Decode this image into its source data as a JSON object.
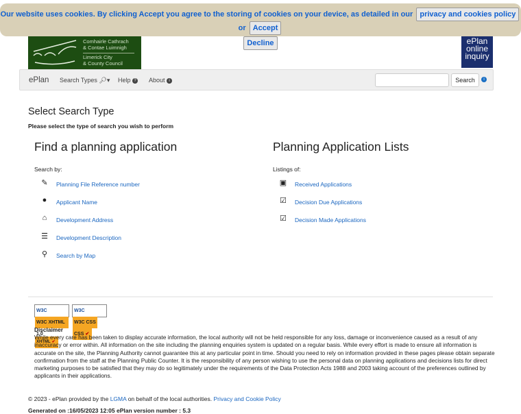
{
  "cookie": {
    "message": "Our website uses cookies. By clicking Accept you agree to the storing of cookies on your device, as detailed in our",
    "policy_button": "privacy and cookies policy",
    "or": "or",
    "accept": "Accept",
    "decline": "Decline"
  },
  "header": {
    "council_line1": "Comhairle Cathrach",
    "council_line2": "& Contae Luimnigh",
    "council_line3": "Limerick City",
    "council_line4": "& County Council",
    "eplan_logo": "ePlan online inquiry"
  },
  "nav": {
    "brand": "ePlan",
    "search_types": "Search Types",
    "help": "Help",
    "about": "About",
    "search_placeholder": "",
    "search_button": "Search"
  },
  "page": {
    "title": "Select Search Type",
    "subtitle": "Please select the type of search you wish to perform"
  },
  "find": {
    "heading": "Find a planning application",
    "label": "Search by:",
    "items": [
      {
        "label": "Planning File Reference number",
        "icon": "pencil-icon"
      },
      {
        "label": "Applicant Name",
        "icon": "user-icon"
      },
      {
        "label": "Development Address",
        "icon": "home-icon"
      },
      {
        "label": "Development Description",
        "icon": "list-icon"
      },
      {
        "label": "Search by Map",
        "icon": "map-marker-icon"
      }
    ]
  },
  "lists": {
    "heading": "Planning Application Lists",
    "label": "Listings of:",
    "items": [
      {
        "label": "Received Applications",
        "icon": "inbox-icon"
      },
      {
        "label": "Decision Due Applications",
        "icon": "edit-icon"
      },
      {
        "label": "Decision Made Applications",
        "icon": "check-icon"
      }
    ]
  },
  "badges": {
    "xhtml": "W3C XHTML 1.0",
    "css": "W3C CSS"
  },
  "disclaimer": {
    "title": "Disclaimer",
    "text": "While every care has been taken to display accurate information, the local authority will not be held responsible for any loss, damage or inconvenience caused as a result of any inaccuracy or error within. All information on the site including the planning enquiries system is updated on a regular basis. While every effort is made to ensure all information is accurate on the site, the Planning Authority cannot guarantee this at any particular point in time. Should you need to rely on information provided in these pages please obtain separate confirmation from the staff at the Planning Public Counter. It is the responsibility of any person wishing to use the personal data on planning applications and decisions lists for direct marketing purposes to be satisfied that they may do so legitimately under the requirements of the Data Protection Acts 1988 and 2003 taking account of the preferences outlined by applicants in their applications."
  },
  "footer": {
    "copyright_pre": "© 2023 - ePlan provided by the",
    "lgma": "LGMA",
    "copyright_mid": "on behalf of the local authorities.",
    "privacy": "Privacy and Cookie Policy",
    "generated": "Generated on :16/05/2023 12:05 ePlan version number : 5.3"
  }
}
